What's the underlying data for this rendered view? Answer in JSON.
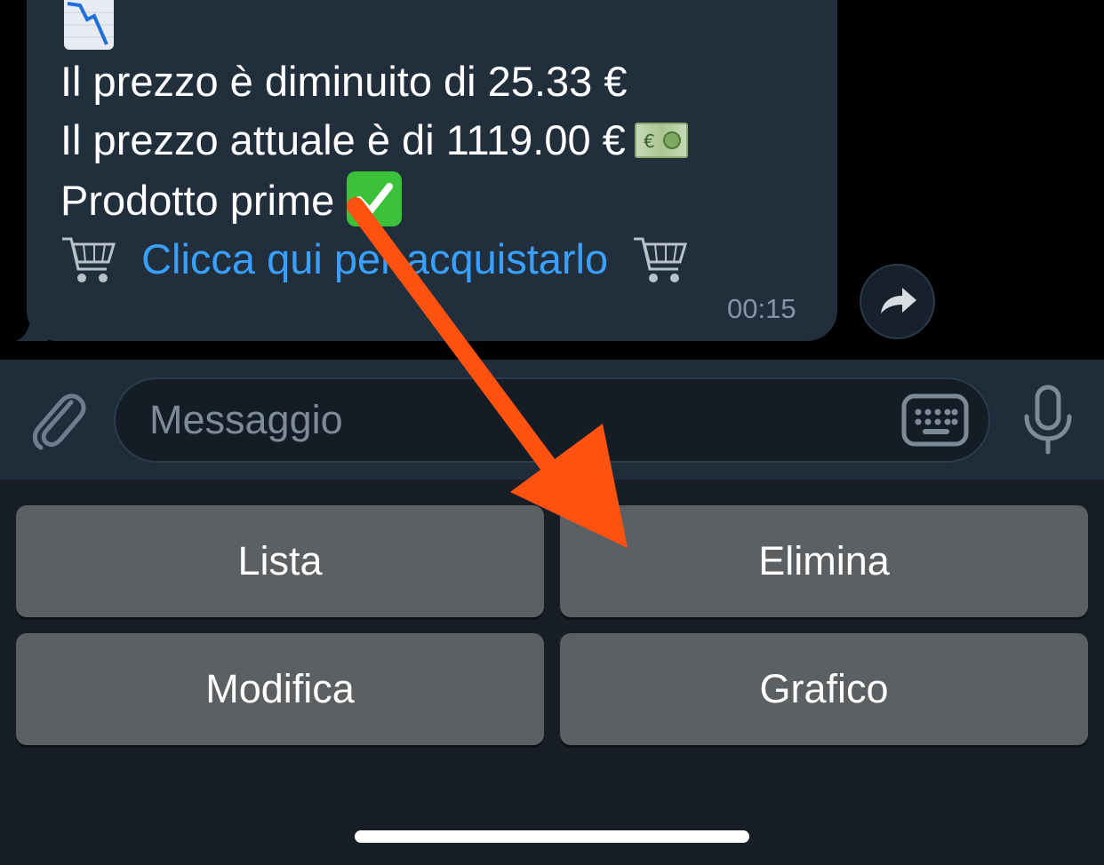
{
  "message": {
    "lines": [
      "Il prezzo è diminuito di 25.33 €",
      "Il prezzo attuale è di 1119.00 €",
      "Prodotto prime"
    ],
    "link_text": "Clicca qui per acquistarlo",
    "time": "00:15",
    "emojis": {
      "top": "chart-decreasing",
      "line2": "euro-banknote",
      "line3": "check-mark-button",
      "link": "shopping-cart"
    }
  },
  "composer": {
    "placeholder": "Messaggio",
    "icons": [
      "paperclip-icon",
      "keyboard-icon",
      "microphone-icon"
    ]
  },
  "bot_keyboard": {
    "buttons": [
      {
        "label": "Lista"
      },
      {
        "label": "Elimina"
      },
      {
        "label": "Modifica"
      },
      {
        "label": "Grafico"
      }
    ]
  },
  "colors": {
    "bubble": "#212f3d",
    "link": "#3aa0ff",
    "button": "#5c6062",
    "annotation_arrow": "#ff5211"
  }
}
